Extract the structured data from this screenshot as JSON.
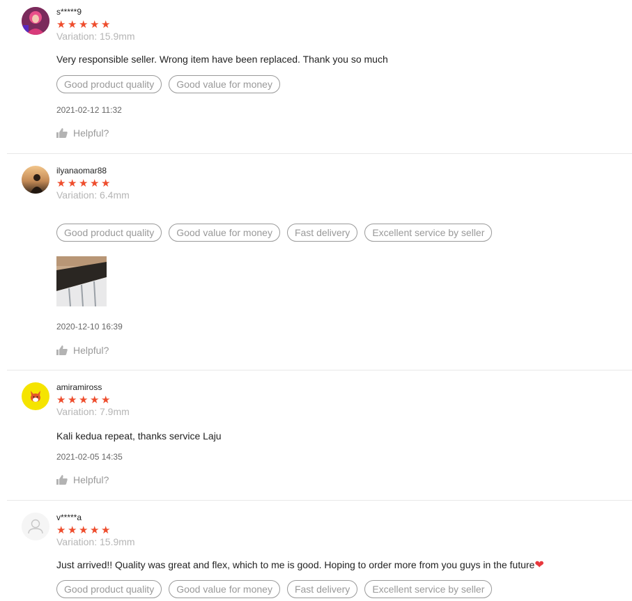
{
  "reviews": [
    {
      "username": "s*****9",
      "rating": 5,
      "variation": "Variation: 15.9mm",
      "comment": "Very responsible seller.  Wrong item have been replaced. Thank you so much",
      "tags": [
        "Good product quality",
        "Good value for money"
      ],
      "date": "2021-02-12 11:32",
      "helpful": "Helpful?"
    },
    {
      "username": "ilyanaomar88",
      "rating": 5,
      "variation": "Variation: 6.4mm",
      "comment": "",
      "tags": [
        "Good product quality",
        "Good value for money",
        "Fast delivery",
        "Excellent service by seller"
      ],
      "date": "2020-12-10 16:39",
      "helpful": "Helpful?"
    },
    {
      "username": "amiramiross",
      "rating": 5,
      "variation": "Variation: 7.9mm",
      "comment": "Kali kedua repeat, thanks service Laju",
      "tags": [],
      "date": "2021-02-05 14:35",
      "helpful": "Helpful?"
    },
    {
      "username": "v*****a",
      "rating": 5,
      "variation": "Variation: 15.9mm",
      "comment": "Just arrived!! Quality was great and flex, which to me is good. Hoping to order more from you guys in the future",
      "comment_emoji": "heart-icon",
      "tags": [
        "Good product quality",
        "Good value for money",
        "Fast delivery",
        "Excellent service by seller"
      ],
      "date": "",
      "helpful": ""
    }
  ],
  "colors": {
    "star": "#ee4d2d",
    "tag_border": "#999999",
    "heart": "#e8383d"
  }
}
